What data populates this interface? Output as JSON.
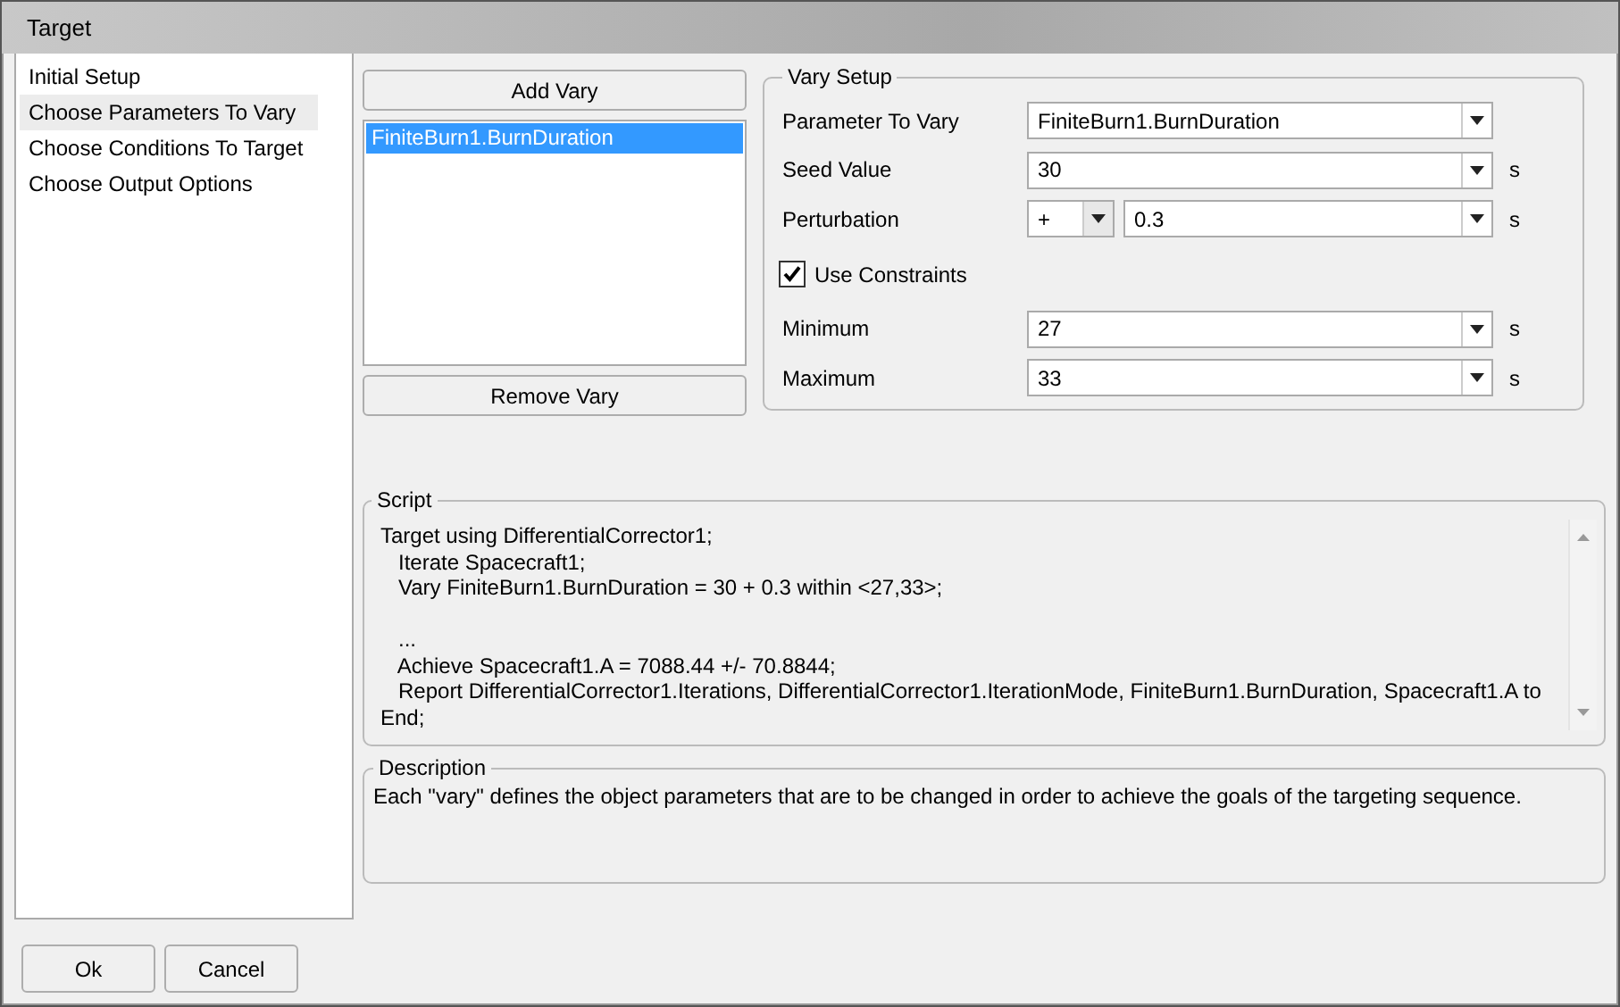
{
  "window": {
    "title": "Target"
  },
  "sidebar": {
    "items": [
      {
        "label": "Initial Setup",
        "selected": false
      },
      {
        "label": "Choose Parameters To Vary",
        "selected": true
      },
      {
        "label": "Choose Conditions To Target",
        "selected": false
      },
      {
        "label": "Choose Output Options",
        "selected": false
      }
    ]
  },
  "vary_list": {
    "add_button": "Add Vary",
    "remove_button": "Remove Vary",
    "items": [
      {
        "label": "FiniteBurn1.BurnDuration",
        "selected": true
      }
    ]
  },
  "vary_setup": {
    "title": "Vary Setup",
    "fields": [
      {
        "kind": "combo",
        "label": "Parameter To Vary",
        "value": "FiniteBurn1.BurnDuration"
      },
      {
        "kind": "combo",
        "label": "Seed Value",
        "value": "30",
        "unit": "s"
      },
      {
        "kind": "split",
        "label": "Perturbation",
        "sign": "+",
        "value": "0.3",
        "unit": "s"
      },
      {
        "kind": "checkbox",
        "label": "Use Constraints",
        "checked": true
      },
      {
        "kind": "combo",
        "label": "Minimum",
        "value": "27",
        "unit": "s"
      },
      {
        "kind": "combo",
        "label": "Maximum",
        "value": "33",
        "unit": "s"
      }
    ]
  },
  "script": {
    "title": "Script",
    "blocks": [
      [
        "Target using DifferentialCorrector1;",
        "   Iterate Spacecraft1;",
        "   Vary FiniteBurn1.BurnDuration = 30 + 0.3 within <27,33>;"
      ],
      [
        "   ...",
        "   Achieve Spacecraft1.A = 7088.44 +/- 70.8844;",
        "   Report DifferentialCorrector1.Iterations, DifferentialCorrector1.IterationMode, FiniteBurn1.BurnDuration, Spacecraft1.A to",
        "End;"
      ]
    ]
  },
  "description": {
    "title": "Description",
    "text": "Each \"vary\" defines the object parameters that are to be changed in order to achieve the goals of the targeting sequence."
  },
  "buttons": [
    "Ok",
    "Cancel"
  ]
}
